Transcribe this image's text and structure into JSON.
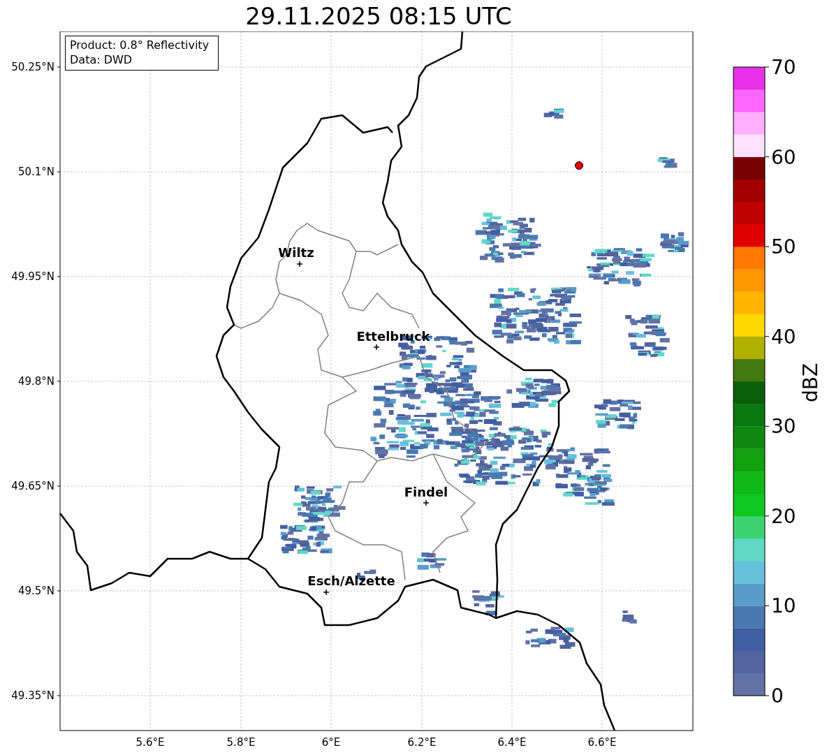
{
  "title": "29.11.2025 08:15 UTC",
  "info_box": {
    "lines": [
      "Product: 0.8° Reflectivity",
      "Data: DWD"
    ]
  },
  "map": {
    "lat_ticks": [
      "50.25°N",
      "50.1°N",
      "49.95°N",
      "49.8°N",
      "49.65°N",
      "49.5°N",
      "49.35°N"
    ],
    "lon_ticks": [
      "5.6°E",
      "5.8°E",
      "6°E",
      "6.2°E",
      "6.4°E",
      "6.6°E"
    ],
    "cities": [
      {
        "name": "Wiltz"
      },
      {
        "name": "Ettelbruck"
      },
      {
        "name": "Findel"
      },
      {
        "name": "Esch/Alzette"
      }
    ]
  },
  "colorbar": {
    "label": "dBZ",
    "ticks": [
      "70",
      "60",
      "50",
      "40",
      "30",
      "20",
      "10",
      "0"
    ],
    "segments": [
      {
        "color": "#6272a6"
      },
      {
        "color": "#52649e"
      },
      {
        "color": "#425ea2"
      },
      {
        "color": "#4a78b0"
      },
      {
        "color": "#5a9cc8"
      },
      {
        "color": "#66c0dc"
      },
      {
        "color": "#5fd8c8"
      },
      {
        "color": "#3dd470"
      },
      {
        "color": "#10c820"
      },
      {
        "color": "#10b818"
      },
      {
        "color": "#10a010"
      },
      {
        "color": "#108810"
      },
      {
        "color": "#0a7810"
      },
      {
        "color": "#0a5e0a"
      },
      {
        "color": "#447810"
      },
      {
        "color": "#b0b000"
      },
      {
        "color": "#ffd800"
      },
      {
        "color": "#ffb400"
      },
      {
        "color": "#ff9800"
      },
      {
        "color": "#ff7800"
      },
      {
        "color": "#e00000"
      },
      {
        "color": "#c00000"
      },
      {
        "color": "#a00000"
      },
      {
        "color": "#780000"
      },
      {
        "color": "#ffe0ff"
      },
      {
        "color": "#ffb0ff"
      },
      {
        "color": "#ff66ff"
      },
      {
        "color": "#e830e8"
      }
    ]
  }
}
